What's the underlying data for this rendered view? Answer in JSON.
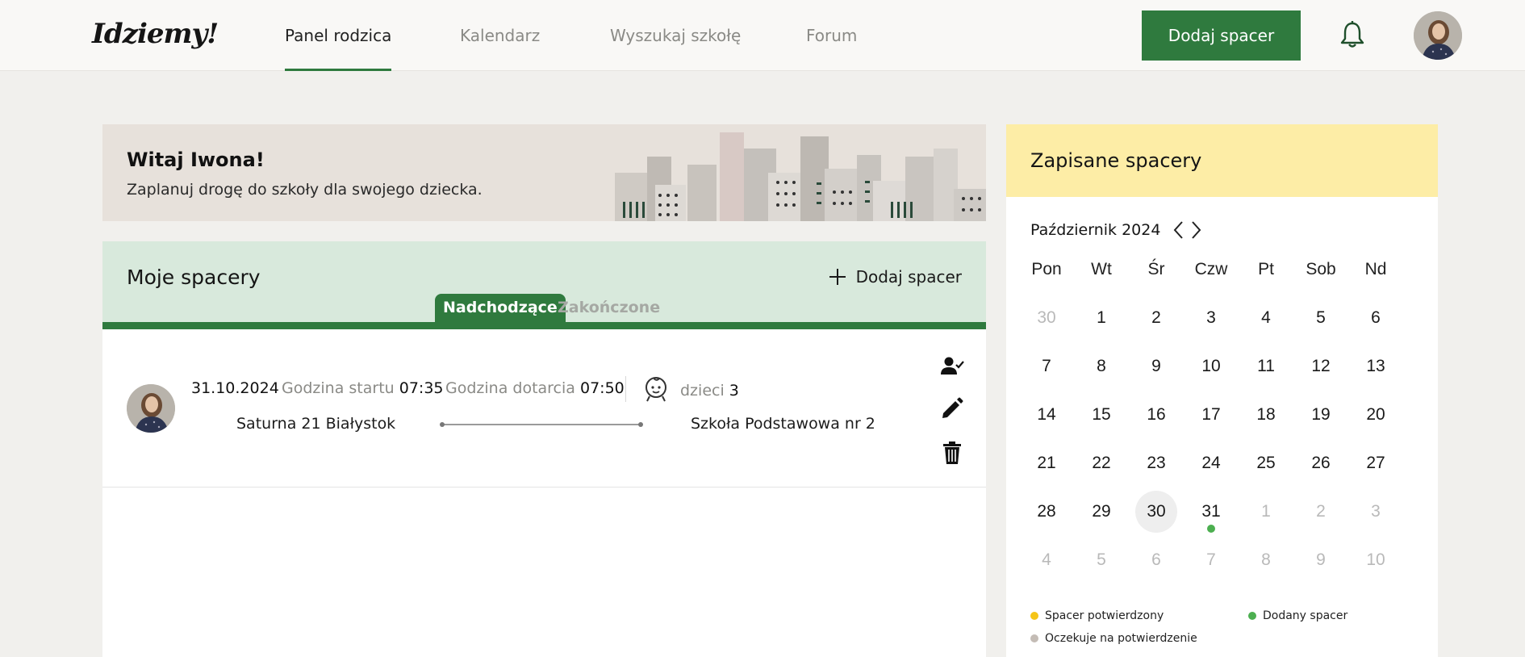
{
  "header": {
    "logo": "Idziemy!",
    "nav": [
      "Panel rodzica",
      "Kalendarz",
      "Wyszukaj szkołę",
      "Forum"
    ],
    "cta": "Dodaj spacer"
  },
  "welcome": {
    "title": "Witaj Iwona!",
    "subtitle": "Zaplanuj drogę do szkoły dla swojego dziecka."
  },
  "walks": {
    "title": "Moje spacery",
    "add_label": "Dodaj spacer",
    "tabs": [
      "Nadchodzące",
      "Zakończone"
    ],
    "items": [
      {
        "date": "31.10.2024",
        "start_label": "Godzina startu",
        "start_time": "07:35",
        "arrive_label": "Godzina dotarcia",
        "arrive_time": "07:50",
        "kids_label": "dzieci",
        "kids_count": "3",
        "from": "Saturna 21 Białystok",
        "to": "Szkoła Podstawowa nr 2"
      }
    ]
  },
  "calendar": {
    "title": "Zapisane spacery",
    "month": "Październik 2024",
    "weekdays": [
      "Pon",
      "Wt",
      "Śr",
      "Czw",
      "Pt",
      "Sob",
      "Nd"
    ],
    "weeks": [
      [
        "30",
        "1",
        "2",
        "3",
        "4",
        "5",
        "6"
      ],
      [
        "7",
        "8",
        "9",
        "10",
        "11",
        "12",
        "13"
      ],
      [
        "14",
        "15",
        "16",
        "17",
        "18",
        "19",
        "20"
      ],
      [
        "21",
        "22",
        "23",
        "24",
        "25",
        "26",
        "27"
      ],
      [
        "28",
        "29",
        "30",
        "31",
        "1",
        "2",
        "3"
      ],
      [
        "4",
        "5",
        "6",
        "7",
        "8",
        "9",
        "10"
      ]
    ],
    "today": "30",
    "walk_day": "31",
    "legend": [
      {
        "label": "Spacer potwierdzony",
        "color": "#f5c518"
      },
      {
        "label": "Dodany spacer",
        "color": "#4caf50"
      },
      {
        "label": "Oczekuje na potwierdzenie",
        "color": "#c4bcb5"
      }
    ]
  },
  "colors": {
    "brand_green": "#2f7a3e",
    "mint": "#d8e9dc",
    "sand": "#e7e1db",
    "yellow": "#fdeda6"
  }
}
